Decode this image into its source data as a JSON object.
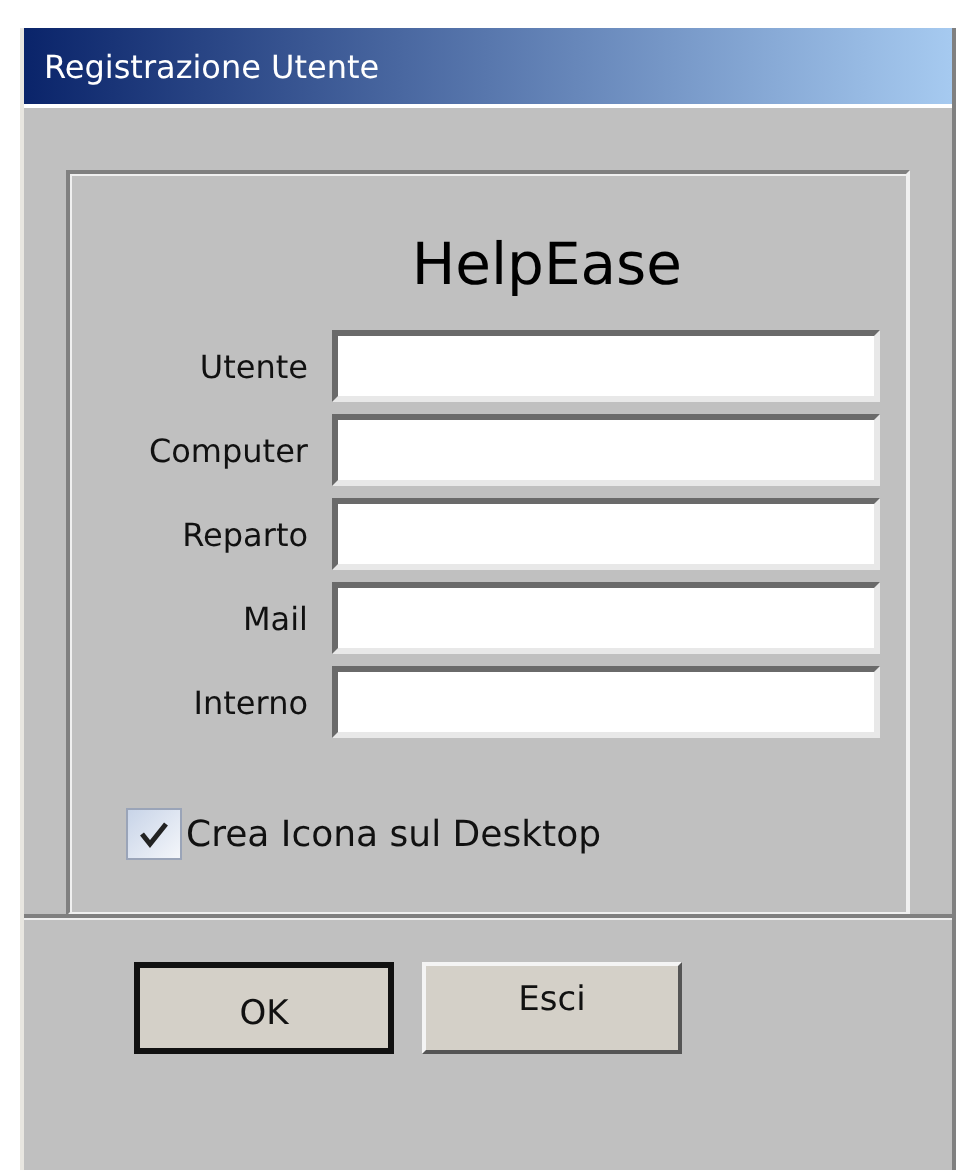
{
  "window": {
    "title": "Registrazione Utente"
  },
  "app_name": "HelpEase",
  "fields": [
    {
      "label": "Utente"
    },
    {
      "label": "Computer"
    },
    {
      "label": "Reparto"
    },
    {
      "label": "Mail"
    },
    {
      "label": "Interno"
    }
  ],
  "checkbox": {
    "label": "Crea Icona sul Desktop",
    "checked": true
  },
  "buttons": [
    {
      "label": "OK",
      "default": true
    },
    {
      "label": "Esci",
      "default": false
    }
  ]
}
